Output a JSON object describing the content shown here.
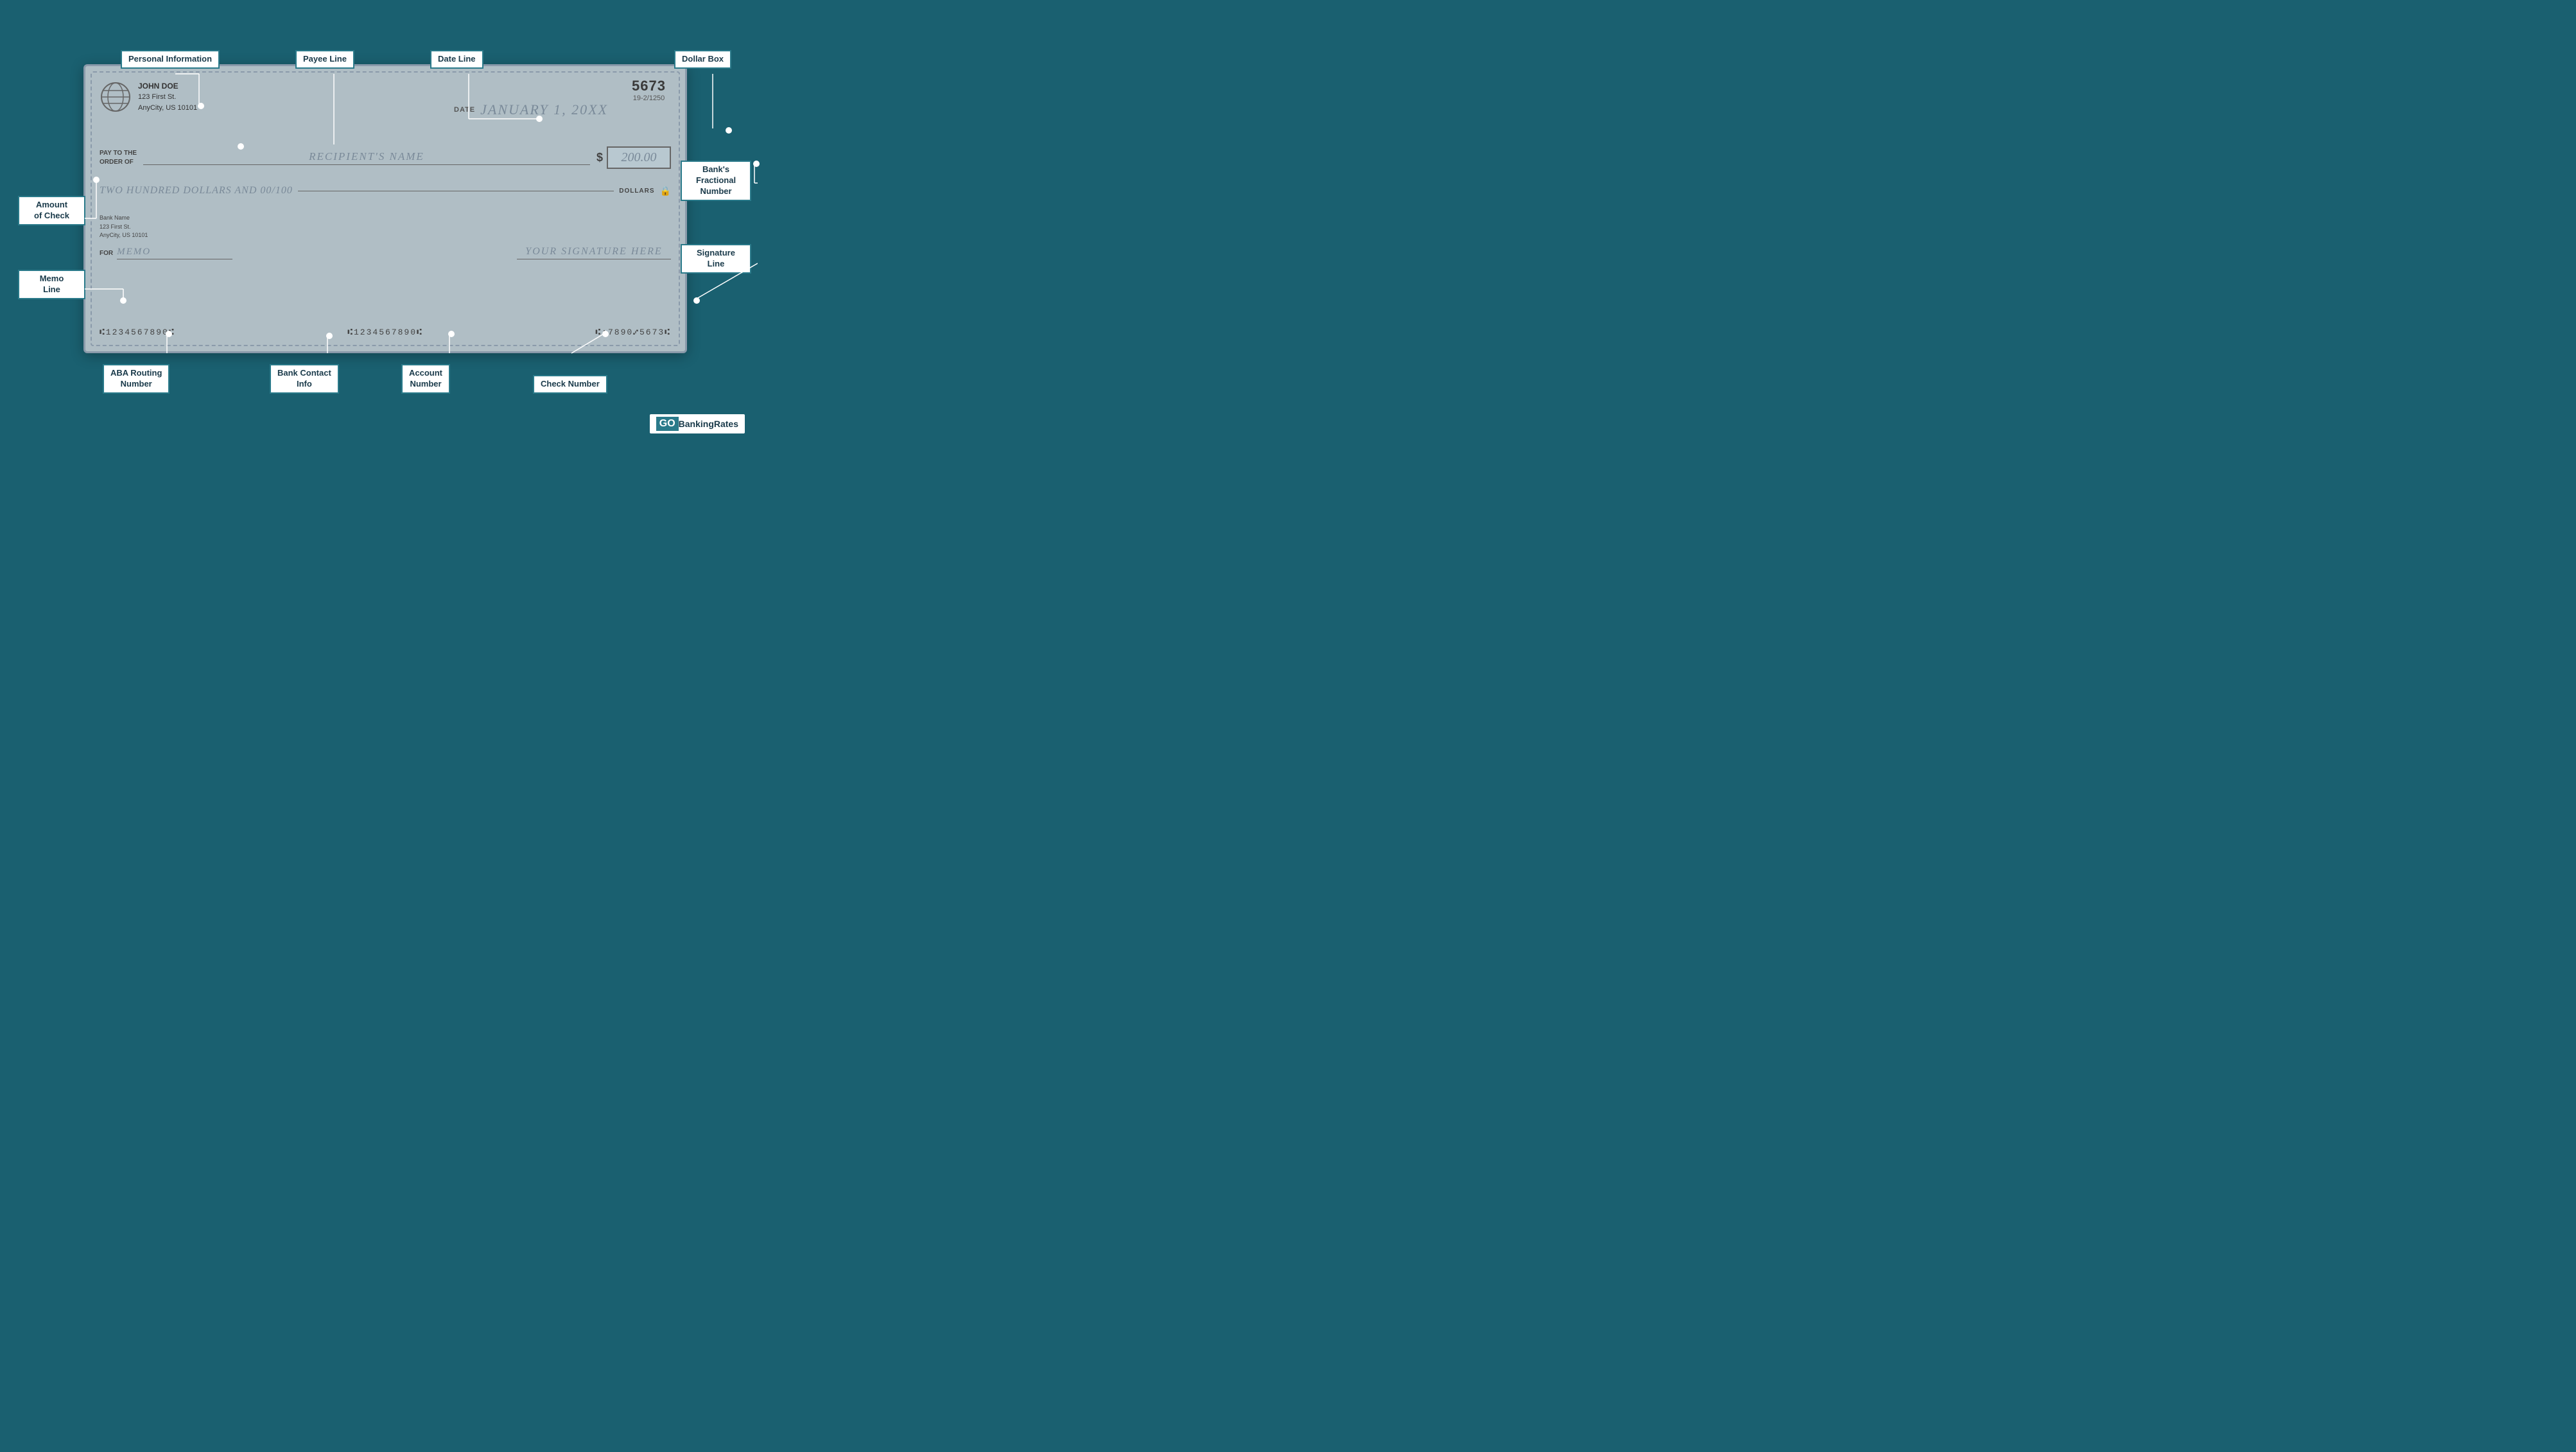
{
  "page": {
    "bg_color": "#1a6070"
  },
  "check": {
    "number": "5673",
    "fractional": "19-2/1250",
    "personal_info": {
      "name": "JOHN DOE",
      "address1": "123 First St.",
      "address2": "AnyCity, US 10101"
    },
    "date_label": "DATE",
    "date_value": "JANUARY 1, 20XX",
    "pay_to_label": "PAY TO THE\nORDER OF",
    "recipient": "RECIPIENT'S NAME",
    "dollar_sign": "$",
    "amount_box": "200.00",
    "written_amount": "TWO HUNDRED DOLLARS AND 00/100",
    "dollars_label": "DOLLARS",
    "bank_name": "Bank Name",
    "bank_address1": "123 First St.",
    "bank_address2": "AnyCity, US 10101",
    "for_label": "FOR",
    "memo": "MEMO",
    "signature": "YOUR SIGNATURE HERE",
    "micr_routing": "⑆1234567890⑆",
    "micr_bank": "⑆1234567890⑆",
    "micr_account": "⑆:7890⑇5673⑆"
  },
  "labels": {
    "personal_information": "Personal Information",
    "payee_line": "Payee Line",
    "date_line": "Date Line",
    "dollar_box": "Dollar Box",
    "banks_fractional_number": "Bank's\nFractional\nNumber",
    "amount_of_check": "Amount\nof Check",
    "memo_line": "Memo\nLine",
    "aba_routing": "ABA Routing\nNumber",
    "bank_contact_info": "Bank Contact\nInfo",
    "account_number": "Account\nNumber",
    "check_number": "Check Number",
    "signature_line": "Signature\nLine"
  },
  "logo": {
    "go": "GO",
    "banking": "BankingRates"
  }
}
